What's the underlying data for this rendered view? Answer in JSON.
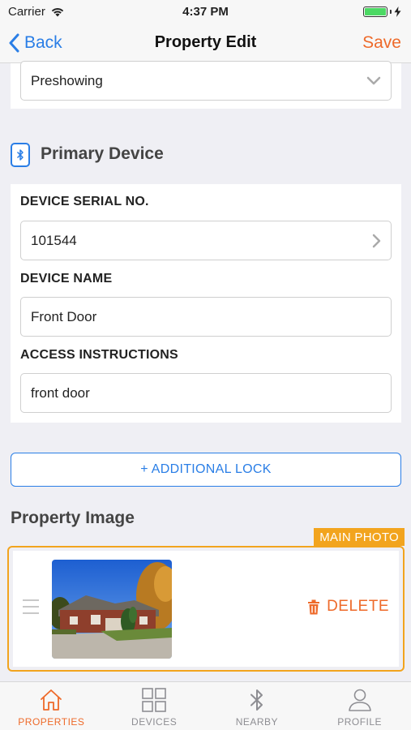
{
  "status_bar": {
    "carrier": "Carrier",
    "time": "4:37 PM"
  },
  "nav": {
    "back_label": "Back",
    "title": "Property Edit",
    "save_label": "Save"
  },
  "status_select": {
    "value": "Preshowing"
  },
  "primary_device": {
    "title": "Primary Device",
    "serial_label": "DEVICE SERIAL NO.",
    "serial_value": "101544",
    "name_label": "DEVICE NAME",
    "name_value": "Front Door",
    "instructions_label": "ACCESS INSTRUCTIONS",
    "instructions_value": "front door"
  },
  "add_lock_label": "+ ADDITIONAL LOCK",
  "property_image": {
    "title": "Property Image",
    "main_photo_tag": "MAIN PHOTO",
    "delete_label": "DELETE"
  },
  "tabs": [
    {
      "label": "PROPERTIES",
      "icon": "home-icon",
      "active": true
    },
    {
      "label": "DEVICES",
      "icon": "grid-icon",
      "active": false
    },
    {
      "label": "NEARBY",
      "icon": "bluetooth-icon",
      "active": false
    },
    {
      "label": "PROFILE",
      "icon": "person-icon",
      "active": false
    }
  ],
  "colors": {
    "accent_orange": "#ee6a2a",
    "accent_blue": "#2a7ee6",
    "main_photo_yellow": "#f2a41e"
  }
}
